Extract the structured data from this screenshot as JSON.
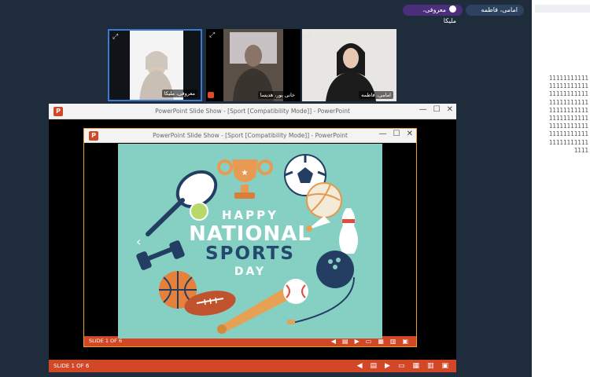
{
  "header": {
    "pill_active": "معروفی، ملیکا",
    "pill_other": "امامی، فاطمه"
  },
  "participants": [
    {
      "name": "معروفی، ملیکا",
      "expand_icon": "expand-icon"
    },
    {
      "name": "خانی پور، هدیسا",
      "expand_icon": "expand-icon"
    },
    {
      "name": "امامی، فاطمه",
      "expand_icon": "expand-icon"
    }
  ],
  "outer_window": {
    "title": "PowerPoint Slide Show - [Sport [Compatibility Mode]] - PowerPoint",
    "minimize": "—",
    "restore": "☐",
    "close": "✕",
    "status_label": "SLIDE 1 OF 6"
  },
  "inner_window": {
    "title": "PowerPoint Slide Show - [Sport [Compatibility Mode]] - PowerPoint",
    "minimize": "—",
    "restore": "☐",
    "close": "✕",
    "status_label": "SLIDE 1 OF 6"
  },
  "slide": {
    "line1": "HAPPY",
    "line2": "NATIONAL",
    "line3": "SPORTS",
    "line4": "DAY",
    "background": "#86d0c3"
  },
  "side_text": {
    "rows": [
      "11111111111",
      "11111111111",
      "11111111111",
      "11111111111",
      "11111111111",
      "11111111111",
      "11111111111",
      "11111111111",
      "11111111111",
      "1111"
    ]
  },
  "colors": {
    "accent_ppt": "#d24726",
    "active_pill": "#4b2f7a"
  }
}
